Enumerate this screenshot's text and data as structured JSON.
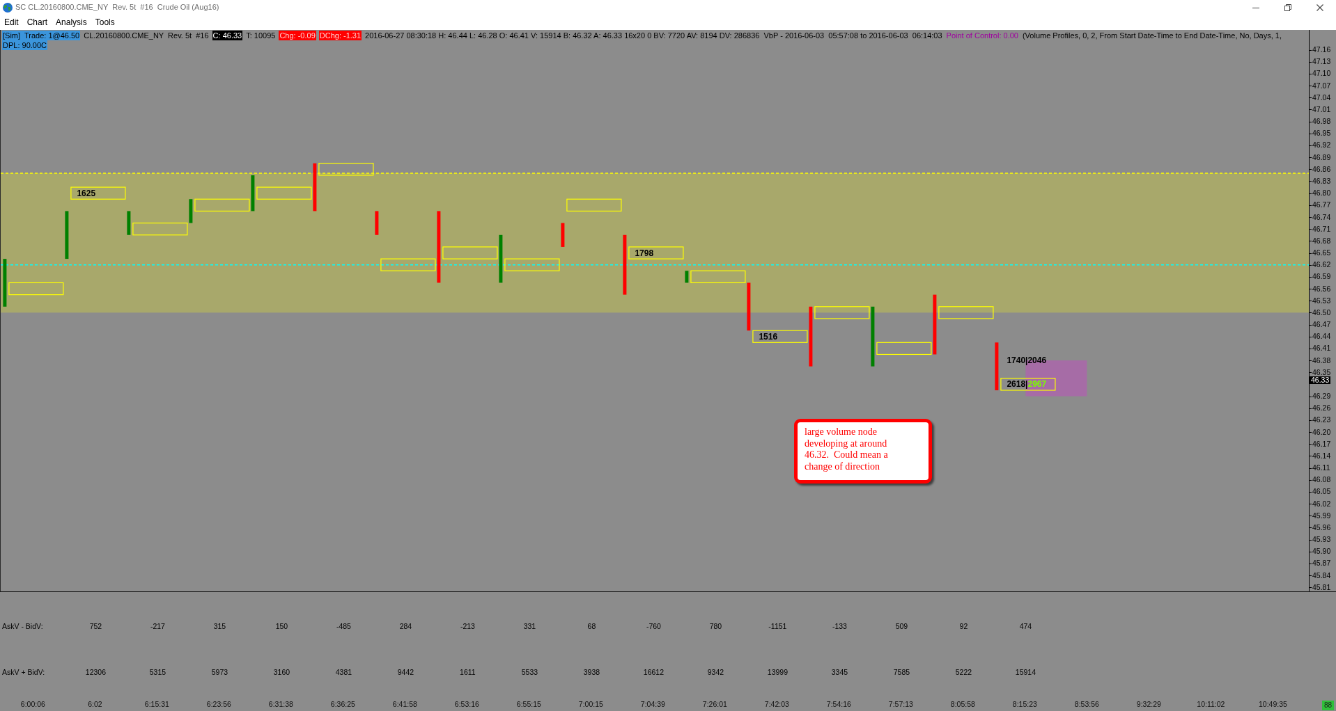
{
  "window": {
    "title": "SC CL.20160800.CME_NY  Rev. 5t  #16  Crude Oil (Aug16)"
  },
  "menu": [
    "Edit",
    "Chart",
    "Analysis",
    "Tools"
  ],
  "info_lines": [
    [
      {
        "text": "[Sim]  Trade: 1@46.50",
        "kind": "highlight"
      },
      {
        "text": "CL.20160800.CME_NY  Rev. 5t  #16",
        "kind": "plain"
      },
      {
        "text": "C: 46.33",
        "kind": "inverse"
      },
      {
        "text": "T: 10095",
        "kind": "plain"
      },
      {
        "text": "Chg: -0.09",
        "kind": "alert"
      },
      {
        "text": "DChg: -1.31",
        "kind": "alert"
      },
      {
        "text": "2016-06-27 08:30:18 H: 46.44 L: 46.28 O: 46.41 V: 15914 B: 46.32 A: 46.33 16x20 0 BV: 7720 AV: 8194 DV: 286836  VbP - 2016-06-03  05:57:08 to 2016-06-03  06:14:03",
        "kind": "plain"
      },
      {
        "text": "Point of Control: 0.00",
        "kind": "accent"
      },
      {
        "text": "(Volume Profiles, 0, 2, From Start Date-Time to End Date-Time, No, Days, 1,",
        "kind": "plain"
      }
    ],
    [
      {
        "text": "DPL: 90.00C",
        "kind": "highlight"
      }
    ]
  ],
  "price_pane": {
    "chart_data": [
      {
        "type": "bar",
        "tick_labels": "y",
        "ylim": [
          45.8,
          47.21
        ],
        "yticks": [
          47.16,
          47.13,
          {
            "value": 47.1,
            "label": "47.10"
          },
          47.07,
          47.04,
          47.01,
          46.98,
          46.95,
          46.92,
          46.89,
          46.86,
          46.83,
          {
            "value": 46.8,
            "label": "46.80"
          },
          46.77,
          46.74,
          46.71,
          46.68,
          46.65,
          46.62,
          46.59,
          46.56,
          46.53,
          {
            "value": 46.5,
            "label": "46.50"
          },
          46.47,
          46.44,
          46.41,
          46.38,
          46.35,
          46.29,
          46.26,
          46.23,
          {
            "value": 46.2,
            "label": "46.20"
          },
          46.17,
          46.14,
          46.11,
          46.08,
          46.05,
          46.02,
          45.99,
          45.96,
          45.93,
          {
            "value": 45.9,
            "label": "45.90"
          },
          45.87,
          45.84,
          45.81
        ],
        "bands": [
          {
            "axis": "y",
            "from": 46.5,
            "to": 46.85,
            "color": "#a8a86b"
          }
        ],
        "ref_lines": [
          {
            "axis": "y",
            "value": 46.85,
            "color": "#ffff00",
            "line_style": "dashed"
          },
          {
            "axis": "y",
            "value": 46.62,
            "color": "#00ffff",
            "line_style": "dashed"
          }
        ],
        "series": [
          {
            "type": "bar",
            "base": [
              46.515,
              46.635,
              46.695,
              46.725,
              46.755,
              46.755,
              46.695,
              46.575,
              46.575,
              46.665,
              46.545,
              46.575,
              46.455,
              46.365,
              46.365,
              46.395,
              46.305,
              null,
              null,
              null,
              null
            ],
            "values": [
              0.12,
              0.12,
              0.06,
              0.06,
              0.09,
              0.12,
              0.06,
              0.18,
              0.12,
              0.06,
              0.15,
              0.03,
              0.12,
              0.15,
              0.15,
              0.15,
              0.12,
              null,
              null,
              null,
              null
            ],
            "colors": [
              "#008000",
              "#008000",
              "#008000",
              "#008000",
              "#008000",
              "#ff0000",
              "#ff0000",
              "#ff0000",
              "#008000",
              "#ff0000",
              "#ff0000",
              "#008000",
              "#ff0000",
              "#ff0000",
              "#008000",
              "#ff0000",
              "#ff0000",
              null,
              null,
              null,
              null
            ]
          },
          {
            "type": "bar",
            "base": [
              46.545,
              46.785,
              46.695,
              46.755,
              46.785,
              46.845,
              46.605,
              46.635,
              46.605,
              46.755,
              46.635,
              46.575,
              46.425,
              46.485,
              46.395,
              46.485,
              46.305,
              null,
              null,
              null,
              null
            ],
            "values": [
              0.03,
              0.03,
              0.03,
              0.03,
              0.03,
              0.03,
              0.03,
              0.03,
              0.03,
              0.03,
              0.03,
              0.03,
              0.03,
              0.03,
              0.03,
              0.03,
              0.03,
              null,
              null,
              null,
              null
            ],
            "color": "#ffff00",
            "value_labels": [
              null,
              [
                {
                  "text": "1625",
                  "color": "#000000"
                }
              ],
              null,
              null,
              null,
              null,
              null,
              null,
              null,
              null,
              [
                {
                  "text": "1798",
                  "color": "#000000"
                }
              ],
              null,
              [
                {
                  "text": "1516",
                  "color": "#000000"
                }
              ],
              null,
              null,
              null,
              [
                {
                  "text": "2618|",
                  "color": "#000000"
                },
                {
                  "text": "2967",
                  "color": "#7cfc00"
                }
              ],
              null,
              null,
              null,
              null
            ]
          },
          {
            "type": "bar",
            "base": [
              null,
              null,
              null,
              null,
              null,
              null,
              null,
              null,
              null,
              null,
              null,
              null,
              null,
              null,
              null,
              null,
              46.29,
              null,
              null,
              null,
              null
            ],
            "values": [
              null,
              null,
              null,
              null,
              null,
              null,
              null,
              null,
              null,
              null,
              null,
              null,
              null,
              null,
              null,
              null,
              0.09,
              null,
              null,
              null,
              null
            ],
            "colors": [
              null,
              null,
              null,
              null,
              null,
              null,
              null,
              null,
              null,
              null,
              null,
              null,
              null,
              null,
              null,
              null,
              "#a66ca6",
              null,
              null,
              null,
              null
            ]
          }
        ],
        "annotations": [
          "1740|2046"
        ]
      }
    ],
    "current_price": "46.33",
    "callout": {
      "text": "large volume node developing at around 46.32.  Could mean a change of direction"
    }
  },
  "study_rows": [
    {
      "label": "AskV - BidV:",
      "values": [
        "752",
        "-217",
        "315",
        "150",
        "-485",
        "284",
        "-213",
        "331",
        "68",
        "-760",
        "780",
        "-1151",
        "-133",
        "509",
        "92",
        "474"
      ]
    },
    {
      "label": "AskV + BidV:",
      "values": [
        "12306",
        "5315",
        "5973",
        "3160",
        "4381",
        "9442",
        "1611",
        "5533",
        "3938",
        "16612",
        "9342",
        "13999",
        "3345",
        "7585",
        "5222",
        "15914"
      ]
    }
  ],
  "time_axis": [
    "6:00:06",
    "6:02",
    "6:15:31",
    "6:23:56",
    "6:31:38",
    "6:36:25",
    "6:41:58",
    "6:53:16",
    "6:55:15",
    "7:00:15",
    "7:04:39",
    "7:26:01",
    "7:42:03",
    "7:54:16",
    "7:57:13",
    "8:05:58",
    "8:15:23",
    "8:53:56",
    "9:32:29",
    "10:11:02",
    "10:49:35"
  ],
  "status_indicator": "88"
}
